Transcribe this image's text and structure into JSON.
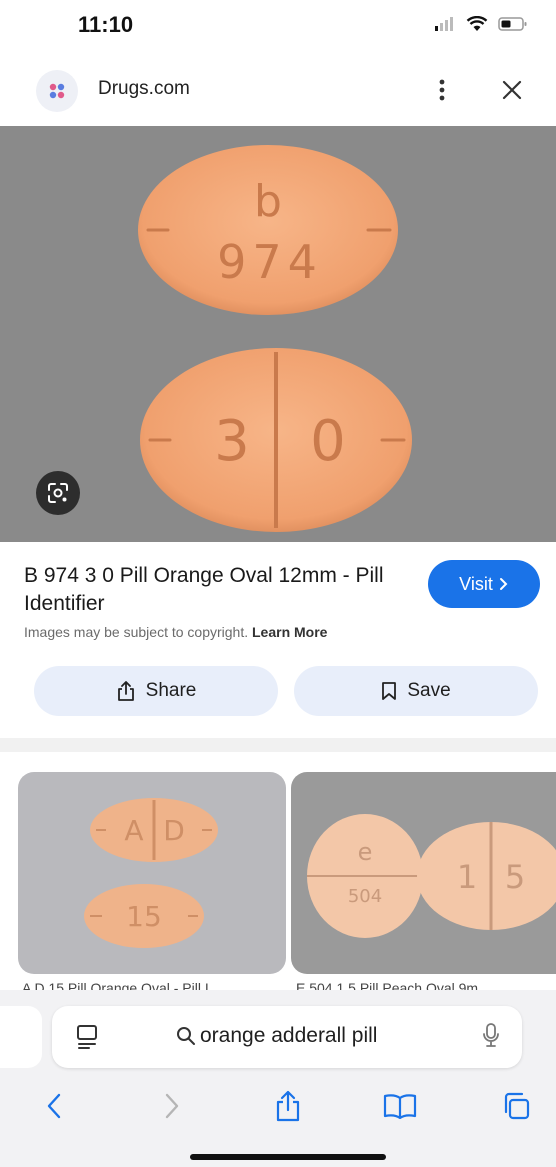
{
  "status_bar": {
    "time": "11:10"
  },
  "header": {
    "site_name": "Drugs.com",
    "icons": {
      "favicon": "drugs-favicon-icon",
      "menu": "more-vertical-icon",
      "close": "close-icon"
    }
  },
  "main_image": {
    "pill_top": {
      "line1": "b",
      "line2": "974"
    },
    "pill_bottom": {
      "left": "3",
      "right": "0"
    },
    "lens_icon": "google-lens-icon"
  },
  "result": {
    "title": "B 974 3 0 Pill Orange Oval 12mm - Pill Identifier",
    "visit_label": "Visit",
    "copyright_text": "Images may be subject to copyright.",
    "learn_more": "Learn More",
    "share_label": "Share",
    "save_label": "Save"
  },
  "related": [
    {
      "caption": "A D 15 Pill Orange Oval - Pill I",
      "pill_a": "A",
      "pill_b": "D",
      "pill_c": "15"
    },
    {
      "caption": "E 504 1 5 Pill Peach Oval 9m",
      "pill_a": "e",
      "pill_b": "504",
      "pill_c1": "1",
      "pill_c2": "5"
    }
  ],
  "address_bar": {
    "query": "orange adderall pill"
  },
  "colors": {
    "accent": "#1a73e8",
    "pill_orange": "#f2a877",
    "image_bg": "#8a8a8a"
  }
}
